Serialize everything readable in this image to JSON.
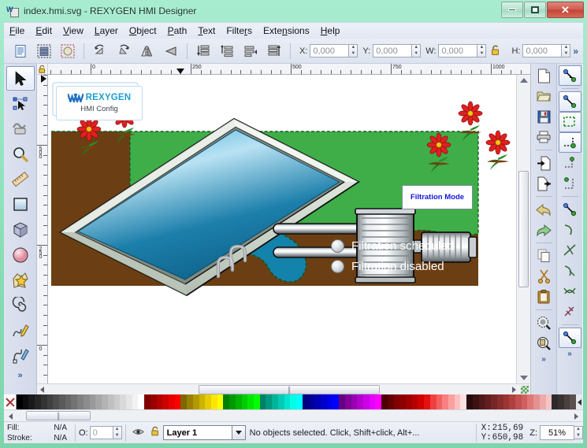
{
  "window": {
    "title": "index.hmi.svg - REXYGEN HMI Designer",
    "app_icon": "inkscape-document-icon",
    "buttons": {
      "minimize": "minimize-button",
      "maximize": "maximize-button",
      "close": "close-button"
    }
  },
  "menu": [
    {
      "label": "File",
      "mnemonic": "F"
    },
    {
      "label": "Edit",
      "mnemonic": "E"
    },
    {
      "label": "View",
      "mnemonic": "V"
    },
    {
      "label": "Layer",
      "mnemonic": "L"
    },
    {
      "label": "Object",
      "mnemonic": "O"
    },
    {
      "label": "Path",
      "mnemonic": "P"
    },
    {
      "label": "Text",
      "mnemonic": "T"
    },
    {
      "label": "Filters",
      "mnemonic": "r"
    },
    {
      "label": "Extensions",
      "mnemonic": "n"
    },
    {
      "label": "Help",
      "mnemonic": "H"
    }
  ],
  "toolbar": {
    "buttons": [
      {
        "name": "select-all-icon",
        "title": "Select All"
      },
      {
        "name": "select-all-layers-icon",
        "title": "Select All in All Layers"
      },
      {
        "name": "deselect-icon",
        "title": "Deselect"
      },
      {
        "name": "rotate-ccw-icon",
        "title": "Rotate 90 CCW"
      },
      {
        "name": "rotate-cw-icon",
        "title": "Rotate 90 CW"
      },
      {
        "name": "flip-horizontal-icon",
        "title": "Flip Horizontal"
      },
      {
        "name": "flip-vertical-icon",
        "title": "Flip Vertical"
      },
      {
        "name": "lower-to-bottom-icon",
        "title": "Lower to Bottom"
      },
      {
        "name": "lower-icon",
        "title": "Lower"
      },
      {
        "name": "raise-icon",
        "title": "Raise"
      },
      {
        "name": "raise-to-top-icon",
        "title": "Raise to Top"
      }
    ],
    "fields": [
      {
        "label": "X:",
        "value": "0,000"
      },
      {
        "label": "Y:",
        "value": "0,000"
      },
      {
        "label": "W:",
        "value": "0,000"
      },
      {
        "label": "H:",
        "value": "0,000"
      }
    ],
    "lock_icon": "lock-wh-ratio-icon",
    "overflow": "»"
  },
  "toolbox": [
    {
      "name": "selector-tool",
      "icon": "arrow-pointer-icon",
      "active": true
    },
    {
      "name": "node-tool",
      "icon": "node-editor-icon",
      "active": false
    },
    {
      "name": "tweak-tool",
      "icon": "tweak-icon",
      "active": false
    },
    {
      "name": "zoom-tool",
      "icon": "magnifier-icon",
      "active": false
    },
    {
      "name": "measure-tool",
      "icon": "ruler-icon",
      "active": false
    },
    {
      "name": "rectangle-tool",
      "icon": "rectangle-icon",
      "active": false
    },
    {
      "name": "box3d-tool",
      "icon": "cube-3d-icon",
      "active": false
    },
    {
      "name": "ellipse-tool",
      "icon": "ellipse-icon",
      "active": false
    },
    {
      "name": "star-tool",
      "icon": "star-icon",
      "active": false
    },
    {
      "name": "spiral-tool",
      "icon": "spiral-icon",
      "active": false
    },
    {
      "name": "pencil-tool",
      "icon": "pencil-icon",
      "active": false
    },
    {
      "name": "calligraphy-tool",
      "icon": "calligraphy-pen-icon",
      "active": false
    }
  ],
  "toolbox_overflow": "»",
  "rulers": {
    "horizontal": [
      "0",
      "250",
      "500",
      "750",
      "1000"
    ],
    "vertical": [
      "500",
      "250",
      "0"
    ],
    "lock_icon": "ruler-lock-icon"
  },
  "right_dock_commands": [
    {
      "name": "new-document-button",
      "icon": "new-page-icon"
    },
    {
      "name": "open-document-button",
      "icon": "folder-open-icon"
    },
    {
      "name": "save-document-button",
      "icon": "floppy-disk-icon"
    },
    {
      "name": "print-button",
      "icon": "printer-icon"
    },
    {
      "name": "import-button",
      "icon": "import-page-icon"
    },
    {
      "name": "export-button",
      "icon": "export-page-icon"
    },
    {
      "name": "undo-button",
      "icon": "undo-arrow-icon"
    },
    {
      "name": "redo-button",
      "icon": "redo-arrow-icon"
    },
    {
      "name": "copy-button",
      "icon": "copy-icon"
    },
    {
      "name": "cut-button",
      "icon": "scissors-icon"
    },
    {
      "name": "paste-button",
      "icon": "clipboard-icon"
    },
    {
      "name": "zoom-drawing-button",
      "icon": "zoom-drawing-icon"
    },
    {
      "name": "zoom-page-button",
      "icon": "zoom-page-icon"
    }
  ],
  "right_dock_snap": [
    {
      "name": "enable-snapping-toggle",
      "icon": "snap-icon",
      "active": true
    },
    {
      "name": "snap-bounding-box-toggle",
      "icon": "snap-bbox-icon",
      "active": true
    },
    {
      "name": "snap-bbox-edges-toggle",
      "icon": "snap-bbox-edge-icon",
      "active": true
    },
    {
      "name": "snap-bbox-corners-toggle",
      "icon": "snap-bbox-corner-icon",
      "active": true
    },
    {
      "name": "snap-edge-midpoints-toggle",
      "icon": "snap-edge-mid-icon",
      "active": false
    },
    {
      "name": "snap-centers-toggle",
      "icon": "snap-center-icon",
      "active": false
    },
    {
      "name": "snap-nodes-toggle",
      "icon": "snap-node-icon",
      "active": false
    },
    {
      "name": "snap-paths-toggle",
      "icon": "snap-path-icon",
      "active": false
    },
    {
      "name": "snap-path-intersections-toggle",
      "icon": "snap-intersection-icon",
      "active": false
    },
    {
      "name": "snap-cusp-nodes-toggle",
      "icon": "snap-cusp-icon",
      "active": false
    },
    {
      "name": "snap-smooth-nodes-toggle",
      "icon": "snap-smooth-icon",
      "active": false
    },
    {
      "name": "snap-midpoints-toggle",
      "icon": "snap-midpoint-icon",
      "active": false
    },
    {
      "name": "snap-others-toggle",
      "icon": "snap-others-icon",
      "active": true
    }
  ],
  "right_dock_overflow": "»",
  "drawing": {
    "logo": {
      "mark": "\\\\\\//",
      "brand": "REXYGEN",
      "subtitle": "HMI Config"
    },
    "filtration_mode_button": "Filtration Mode",
    "status_lines": [
      {
        "lamp": "indicator-lamp-off",
        "label": "Filtration scheduled"
      },
      {
        "lamp": "indicator-lamp-off",
        "label": "Filtration disabled"
      }
    ],
    "colors": {
      "grass": "#3fae49",
      "soil": "#6b3f13",
      "water": "#1383ab",
      "pool_deep": "#0d5f86",
      "pool_shallow": "#bfe3f2",
      "coping": "#d8e0d6",
      "flower_petal": "#e02020",
      "flower_center": "#ffc20e",
      "metal": "#c9cdd1"
    }
  },
  "palette": {
    "none_swatch": "no-color-x-icon",
    "colors": [
      "#000000",
      "#0d0d0d",
      "#1a1a1a",
      "#262626",
      "#333333",
      "#404040",
      "#4d4d4d",
      "#5a5a5a",
      "#666666",
      "#737373",
      "#808080",
      "#8c8c8c",
      "#999999",
      "#a6a6a6",
      "#b3b3b3",
      "#c0c0c0",
      "#cccccc",
      "#d9d9d9",
      "#e6e6e6",
      "#f2f2f2",
      "#ffffff",
      "#800000",
      "#990000",
      "#b30000",
      "#cc0000",
      "#e60000",
      "#ff0000",
      "#806600",
      "#998000",
      "#b39900",
      "#ccb300",
      "#e6cc00",
      "#ffe600",
      "#ffff00",
      "#008000",
      "#009900",
      "#00b300",
      "#00cc00",
      "#00e600",
      "#00ff00",
      "#008066",
      "#009980",
      "#00b399",
      "#00ccb3",
      "#00e6cc",
      "#00ffe6",
      "#00ffff",
      "#000080",
      "#000099",
      "#0000b3",
      "#0000cc",
      "#0000e6",
      "#0000ff",
      "#660080",
      "#800099",
      "#9900b3",
      "#b300cc",
      "#cc00e6",
      "#e600ff",
      "#ff00ff",
      "#4d0000",
      "#660000",
      "#800000",
      "#8c0000",
      "#a00000",
      "#b80000",
      "#d00000",
      "#e41010",
      "#ef4040",
      "#f46060",
      "#f88080",
      "#faa0a0",
      "#fcc0c0",
      "#fde0e0",
      "#2a0b0b",
      "#3d1212",
      "#501818",
      "#631f1f",
      "#762626",
      "#892d2d",
      "#9c3434",
      "#af4040",
      "#c25050",
      "#d06060",
      "#dc7878",
      "#e69090",
      "#eeaaaa",
      "#f4c4c4",
      "#2b2b2b",
      "#3a3232",
      "#494040",
      "#5a4e4e"
    ],
    "scroll_left": "scroll-left-arrow",
    "scroll_right": "scroll-right-arrow"
  },
  "statusbar": {
    "fill_label": "Fill:",
    "fill_value": "N/A",
    "stroke_label": "Stroke:",
    "stroke_value": "N/A",
    "opacity_label": "O:",
    "opacity_value": "0",
    "visibility_icon": "eye-icon",
    "lock_icon": "layer-lock-icon",
    "layer_name": "Layer 1",
    "message": "No objects selected. Click, Shift+click, Alt+...",
    "x_label": "X:",
    "x_value": "215,69",
    "y_label": "Y:",
    "y_value": "650,98",
    "zoom_label": "Z:",
    "zoom_value": "51%"
  }
}
